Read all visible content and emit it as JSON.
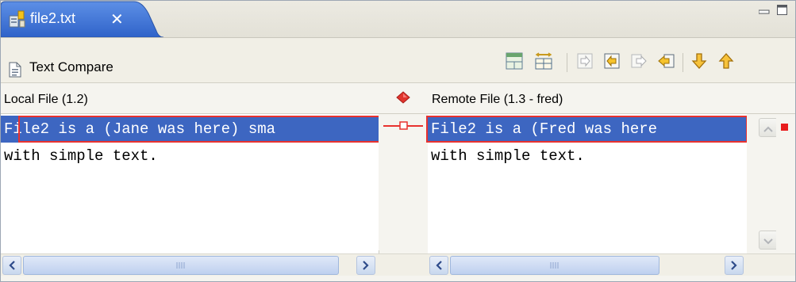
{
  "tab": {
    "title": "file2.txt",
    "close_glyph": "✕",
    "icon": "text-file-icon"
  },
  "window_controls": {
    "minimize_icon": "minimize-icon",
    "maximize_icon": "maximize-icon"
  },
  "toolbar": {
    "title": "Text Compare",
    "title_icon": "document-icon",
    "buttons": [
      {
        "name": "show-ancestor-pane-button",
        "icon": "ancestor-pane-icon"
      },
      {
        "name": "ignore-whitespace-button",
        "icon": "whitespace-icon"
      },
      {
        "name": "copy-all-left-to-right-button",
        "icon": "copy-all-right-icon"
      },
      {
        "name": "copy-current-left-to-right-button",
        "icon": "copy-right-icon"
      },
      {
        "name": "copy-current-right-to-left-button",
        "icon": "copy-left-icon"
      },
      {
        "name": "copy-all-right-to-left-button",
        "icon": "copy-all-left-icon"
      },
      {
        "name": "next-difference-button",
        "icon": "arrow-down-icon"
      },
      {
        "name": "previous-difference-button",
        "icon": "arrow-up-icon"
      }
    ]
  },
  "left": {
    "header": "Local File (1.2)",
    "lines": [
      "File2 is a (Jane was here) sma",
      "with simple text."
    ]
  },
  "right": {
    "header": "Remote File (1.3 - fred)",
    "lines": [
      "File2 is a (Fred was here",
      "with simple text."
    ]
  },
  "colors": {
    "selection": "#3d66c1",
    "diff_highlight": "#e8322f",
    "tab_active": "#3f74d6"
  }
}
